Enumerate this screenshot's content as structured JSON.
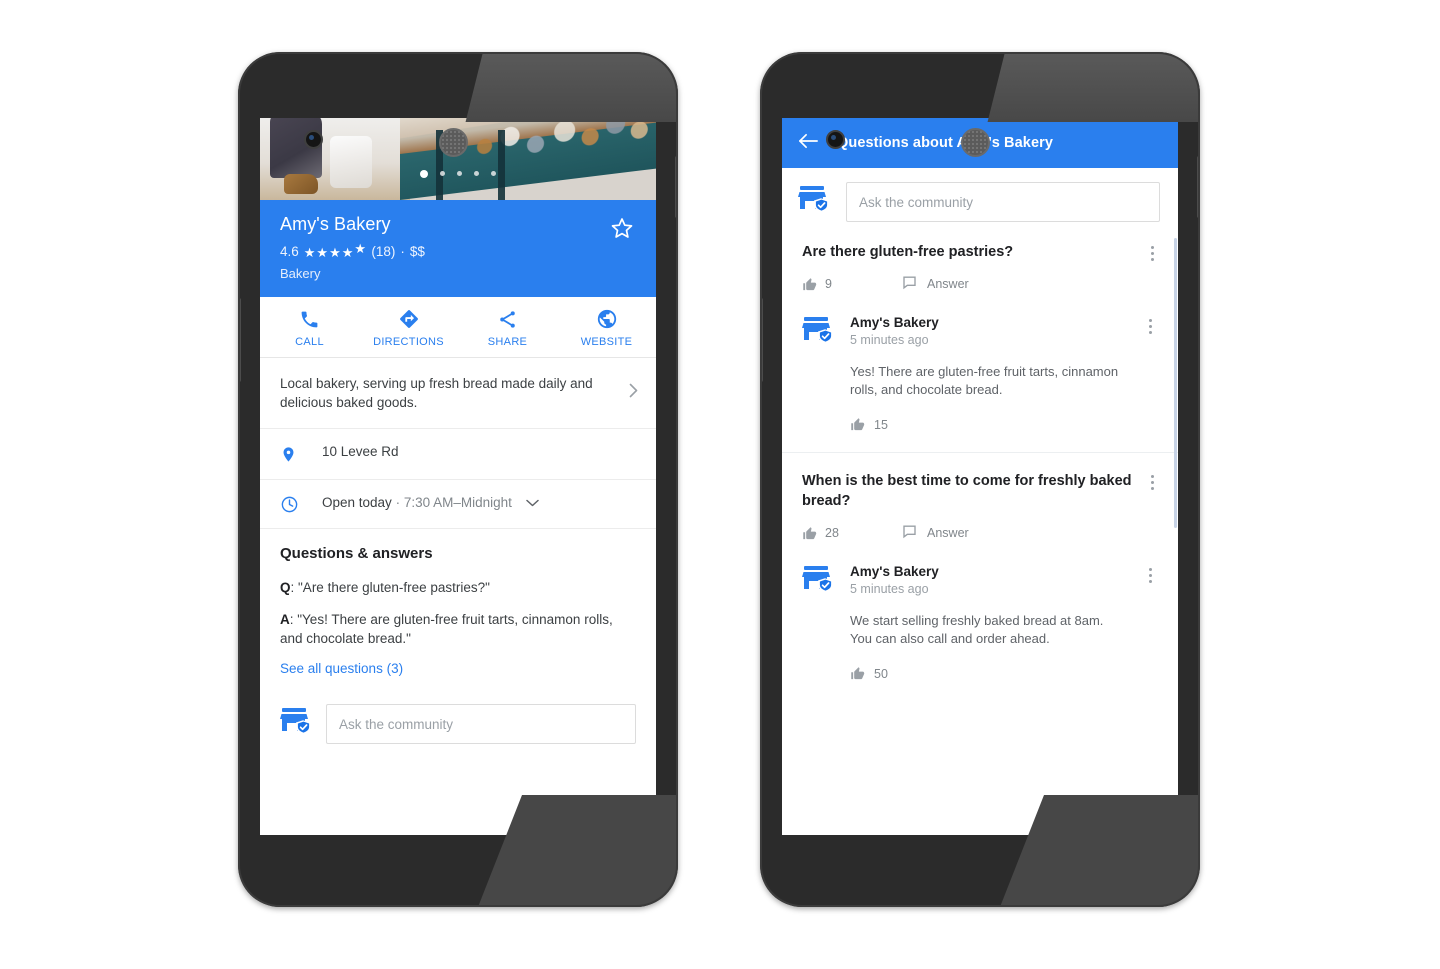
{
  "phone1": {
    "name": "place-detail-screen",
    "photo_carousel": {
      "total_dots": 5,
      "active_index": 0
    },
    "place": {
      "title": "Amy's Bakery",
      "rating_value": "4.6",
      "stars": "★★★★",
      "half_star": "★",
      "review_count": "(18)",
      "separator": "·",
      "price_level": "$$",
      "category": "Bakery",
      "save_icon": "star-outline-icon"
    },
    "actions": [
      {
        "label": "CALL",
        "icon": "phone-icon"
      },
      {
        "label": "DIRECTIONS",
        "icon": "directions-icon"
      },
      {
        "label": "SHARE",
        "icon": "share-icon"
      },
      {
        "label": "WEBSITE",
        "icon": "globe-icon"
      }
    ],
    "description": "Local bakery, serving up fresh bread made daily and delicious baked goods.",
    "description_chevron": "chevron-right-icon",
    "address": {
      "icon": "map-pin-icon",
      "text": "10 Levee Rd"
    },
    "hours": {
      "icon": "clock-icon",
      "status": "Open today",
      "separator": "·",
      "range": "7:30 AM–Midnight",
      "chevron": "chevron-down-icon"
    },
    "qa": {
      "title": "Questions & answers",
      "q_label": "Q",
      "q_text": ": \"Are there gluten-free pastries?\"",
      "a_label": "A",
      "a_text": ": \"Yes! There are gluten-free fruit tarts, cinnamon rolls, and chocolate bread.\"",
      "see_all": "See all questions (3)"
    },
    "ask": {
      "avatar_icon": "store-verified-icon",
      "placeholder": "Ask the community",
      "value": ""
    }
  },
  "phone2": {
    "name": "questions-list-screen",
    "appbar": {
      "back_icon": "arrow-back-icon",
      "title": "Questions about Amy's Bakery"
    },
    "ask": {
      "avatar_icon": "store-verified-icon",
      "placeholder": "Ask the community",
      "value": ""
    },
    "labels": {
      "answer": "Answer",
      "thumb_icon": "thumb-up-icon",
      "comment_icon": "comment-icon",
      "kebab_icon": "more-vertical-icon",
      "avatar_icon": "store-verified-icon"
    },
    "questions": [
      {
        "text": "Are there gluten-free pastries?",
        "votes": "9",
        "answer": {
          "author": "Amy's Bakery",
          "time": "5 minutes ago",
          "text": "Yes! There are gluten-free fruit tarts, cinnamon rolls, and chocolate bread.",
          "votes": "15"
        }
      },
      {
        "text": "When is the best time to come for freshly baked bread?",
        "votes": "28",
        "answer": {
          "author": "Amy's Bakery",
          "time": "5 minutes ago",
          "text": "We start selling freshly baked bread at 8am. You can also call and order ahead.",
          "votes": "50"
        }
      }
    ]
  },
  "colors": {
    "accent_blue": "#2a7fee",
    "link_blue": "#2a7fee",
    "text_primary": "#202124",
    "text_secondary": "#5f6368",
    "text_muted": "#9aa0a6",
    "chassis": "#2b2b2b"
  }
}
